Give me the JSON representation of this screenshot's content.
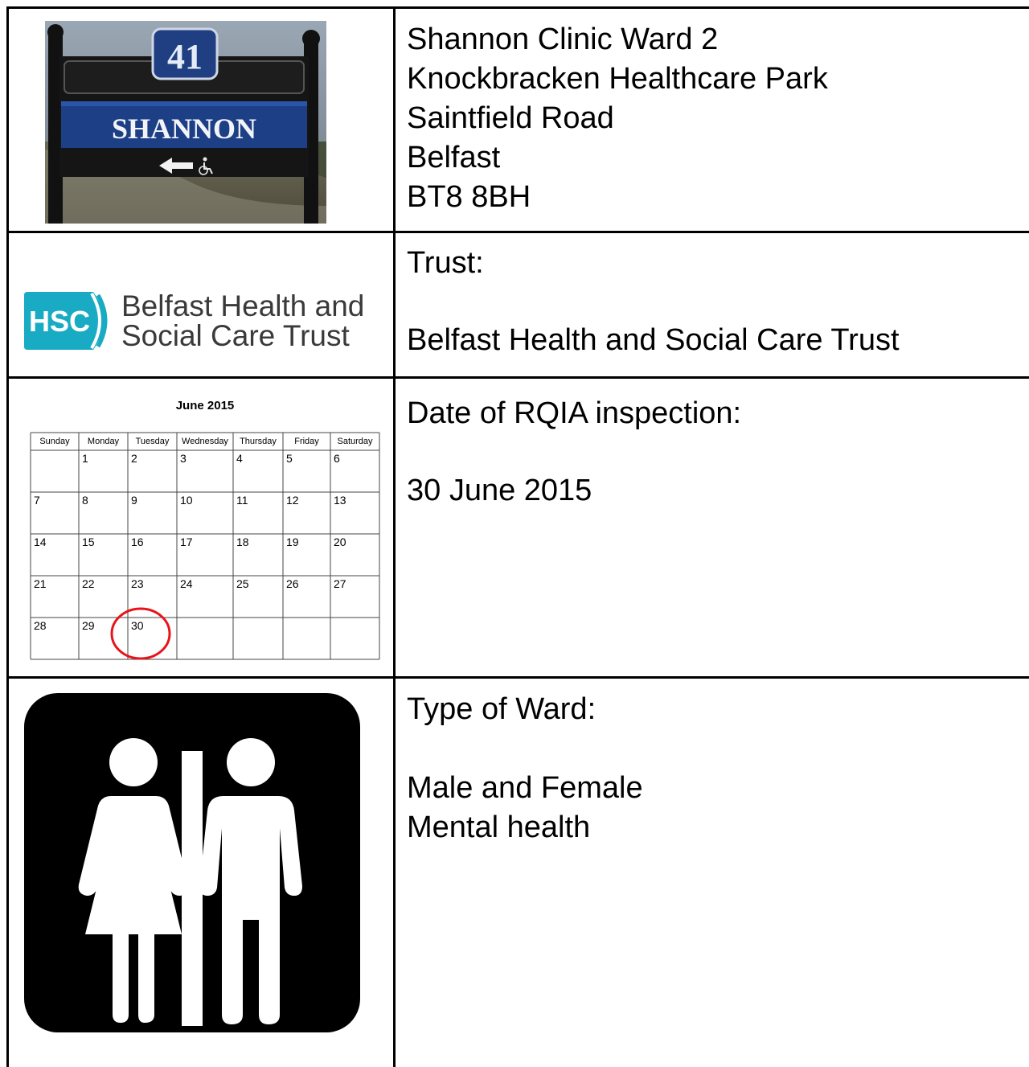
{
  "address": {
    "lines": [
      "Shannon Clinic Ward 2",
      "Knockbracken Healthcare Park",
      "Saintfield Road",
      "Belfast",
      "BT8 8BH"
    ]
  },
  "sign_photo": {
    "number": "41",
    "name": "SHANNON"
  },
  "logo": {
    "badge": "HSC",
    "name_line1": "Belfast Health and",
    "name_line2": "Social Care Trust",
    "colors": {
      "badge": "#1aabc4",
      "text": "#3a3a3a"
    }
  },
  "trust": {
    "label": "Trust:",
    "value": "Belfast Health and Social Care Trust"
  },
  "calendar": {
    "title": "June 2015",
    "weekdays": [
      "Sunday",
      "Monday",
      "Tuesday",
      "Wednesday",
      "Thursday",
      "Friday",
      "Saturday"
    ],
    "weeks": [
      [
        "",
        "1",
        "2",
        "3",
        "4",
        "5",
        "6"
      ],
      [
        "7",
        "8",
        "9",
        "10",
        "11",
        "12",
        "13"
      ],
      [
        "14",
        "15",
        "16",
        "17",
        "18",
        "19",
        "20"
      ],
      [
        "21",
        "22",
        "23",
        "24",
        "25",
        "26",
        "27"
      ],
      [
        "28",
        "29",
        "30",
        "",
        "",
        "",
        ""
      ]
    ],
    "highlighted_day": "30",
    "highlight_color": "#e8141b"
  },
  "inspection": {
    "label": "Date of RQIA inspection:",
    "value": "30 June 2015"
  },
  "ward": {
    "label": "Type of Ward:",
    "line1": "Male and Female",
    "line2": "Mental health",
    "icon": "restroom-male-female-icon"
  }
}
